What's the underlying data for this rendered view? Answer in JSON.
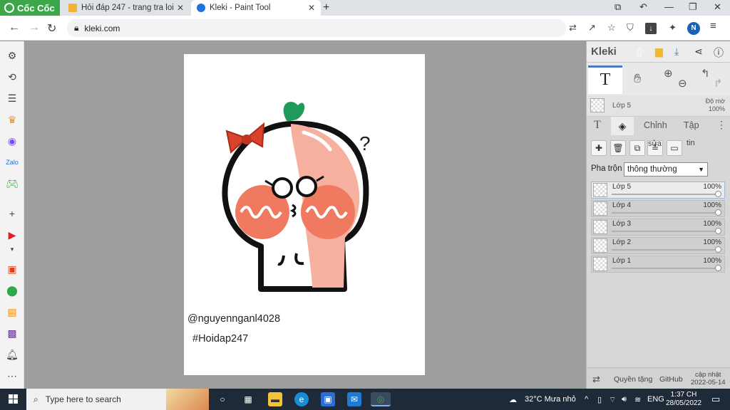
{
  "browser": {
    "brand": "Cốc Cốc",
    "tabs": [
      {
        "title": "Hỏi đáp 247 - trang tra loi",
        "active": false
      },
      {
        "title": "Kleki - Paint Tool",
        "active": true
      }
    ],
    "new_tab": "+",
    "url": "kleki.com",
    "profile_initial": "N"
  },
  "canvas": {
    "caption_line1": "@nguyennganl4028",
    "caption_line2": "#Hoidap247",
    "question_mark": "?"
  },
  "kleki": {
    "logo": "Kleki",
    "current_layer": {
      "name": "Lớp 5",
      "opacity_label": "Độ mờ",
      "opacity": "100%"
    },
    "tabs": {
      "text": "T",
      "adjust": "Chỉnh sửa",
      "file": "Tập tin"
    },
    "blend": {
      "label": "Pha trộn",
      "value": "thông thường"
    },
    "layers": [
      {
        "name": "Lớp 5",
        "opacity": "100%",
        "active": true
      },
      {
        "name": "Lớp 4",
        "opacity": "100%",
        "active": false
      },
      {
        "name": "Lớp 3",
        "opacity": "100%",
        "active": false
      },
      {
        "name": "Lớp 2",
        "opacity": "100%",
        "active": false
      },
      {
        "name": "Lớp 1",
        "opacity": "100%",
        "active": false
      }
    ],
    "footer": {
      "privacy": "Quyền tặng",
      "github": "GitHub",
      "update_label": "cập nhật",
      "update_date": "2022-05-14"
    }
  },
  "taskbar": {
    "search_placeholder": "Type here to search",
    "weather": "32°C  Mưa nhỏ",
    "language": "ENG",
    "time": "1:37 CH",
    "date": "28/05/2022"
  },
  "colors": {
    "brand_green": "#3ea64a",
    "kleki_accent": "#4a78c8",
    "taskbar": "#1f2a38"
  }
}
